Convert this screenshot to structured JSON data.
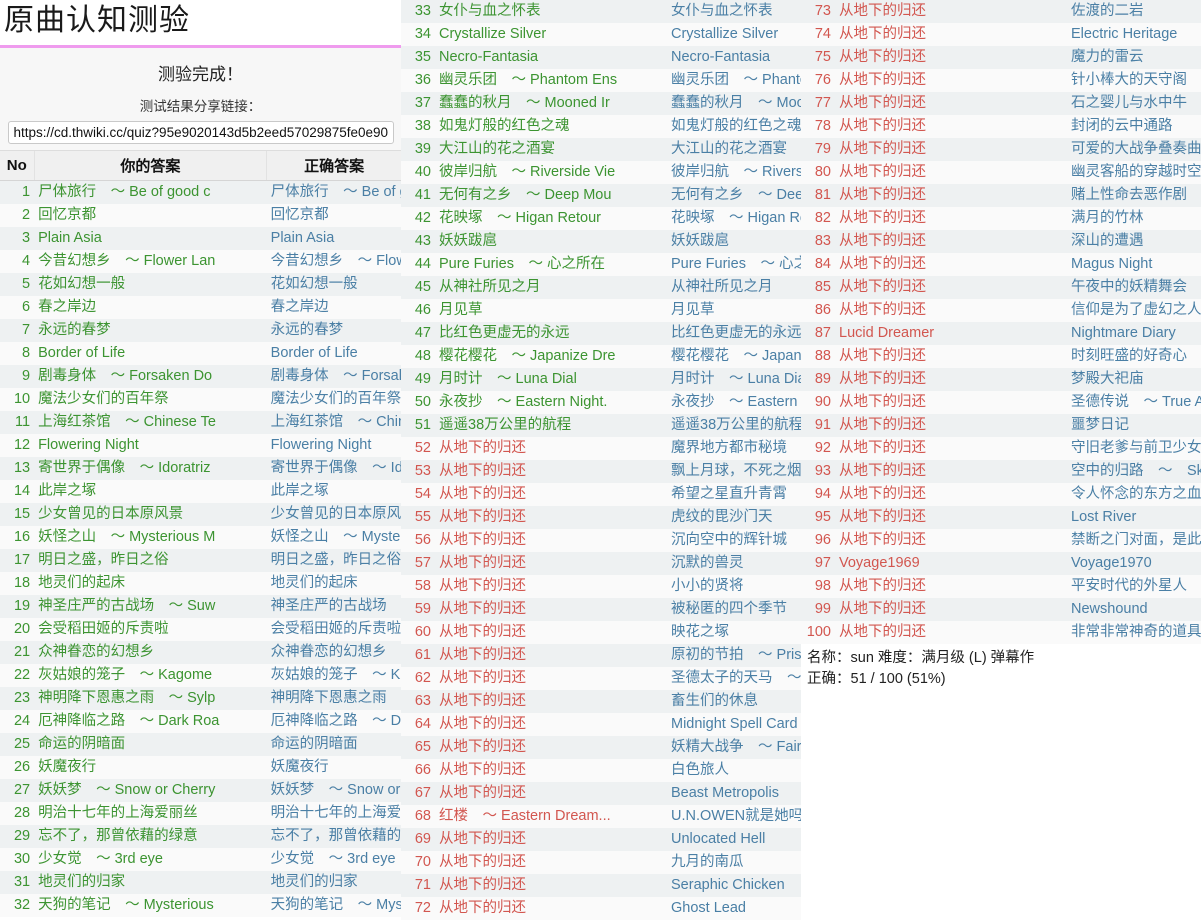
{
  "header": {
    "title": "原曲认知测验",
    "complete_text": "测验完成！",
    "share_label": "测试结果分享链接：",
    "share_url": "https://cd.thwiki.cc/quiz?95e9020143d5b2eed57029875fe0e90d",
    "accent_color": "#ef9bee"
  },
  "table": {
    "columns": [
      "No",
      "你的答案",
      "正确答案"
    ],
    "correct_color": "#3c9431",
    "wrong_color": "#d2564f",
    "answer_color": "#4a7fa5"
  },
  "summary": {
    "line1": "名称：sun 难度：满月级 (L) 弹幕作",
    "line2": "正确：51 / 100 (51%)"
  },
  "rows": [
    {
      "no": "1",
      "user": "尸体旅行　～ Be of good c",
      "correct": "尸体旅行　～ Be of good c",
      "ok": true
    },
    {
      "no": "2",
      "user": "回忆京都",
      "correct": "回忆京都",
      "ok": true
    },
    {
      "no": "3",
      "user": "Plain Asia",
      "correct": "Plain Asia",
      "ok": true
    },
    {
      "no": "4",
      "user": "今昔幻想乡　～ Flower Lan",
      "correct": "今昔幻想乡　～ Flower Lan",
      "ok": true
    },
    {
      "no": "5",
      "user": "花如幻想一般",
      "correct": "花如幻想一般",
      "ok": true
    },
    {
      "no": "6",
      "user": "春之岸边",
      "correct": "春之岸边",
      "ok": true
    },
    {
      "no": "7",
      "user": "永远的春梦",
      "correct": "永远的春梦",
      "ok": true
    },
    {
      "no": "8",
      "user": "Border of Life",
      "correct": "Border of Life",
      "ok": true
    },
    {
      "no": "9",
      "user": "剧毒身体　～ Forsaken Do",
      "correct": "剧毒身体　～ Forsaken Do",
      "ok": true
    },
    {
      "no": "10",
      "user": "魔法少女们的百年祭",
      "correct": "魔法少女们的百年祭",
      "ok": true
    },
    {
      "no": "11",
      "user": "上海红茶馆　～ Chinese Te",
      "correct": "上海红茶馆　～ Chinese Te",
      "ok": true
    },
    {
      "no": "12",
      "user": "Flowering Night",
      "correct": "Flowering Night",
      "ok": true
    },
    {
      "no": "13",
      "user": "寄世界于偶像　～ Idoratriz",
      "correct": "寄世界于偶像　～ Idoratriz",
      "ok": true
    },
    {
      "no": "14",
      "user": "此岸之塚",
      "correct": "此岸之塚",
      "ok": true
    },
    {
      "no": "15",
      "user": "少女曾见的日本原风景",
      "correct": "少女曾见的日本原风景",
      "ok": true
    },
    {
      "no": "16",
      "user": "妖怪之山　～ Mysterious M",
      "correct": "妖怪之山　～ Mysterious M",
      "ok": true
    },
    {
      "no": "17",
      "user": "明日之盛，昨日之俗",
      "correct": "明日之盛，昨日之俗",
      "ok": true
    },
    {
      "no": "18",
      "user": "地灵们的起床",
      "correct": "地灵们的起床",
      "ok": true
    },
    {
      "no": "19",
      "user": "神圣庄严的古战场　～ Suw",
      "correct": "神圣庄严的古战场　～ Suw",
      "ok": true
    },
    {
      "no": "20",
      "user": "会受稻田姬的斥责啦",
      "correct": "会受稻田姬的斥责啦",
      "ok": true
    },
    {
      "no": "21",
      "user": "众神眷恋的幻想乡",
      "correct": "众神眷恋的幻想乡",
      "ok": true
    },
    {
      "no": "22",
      "user": "灰姑娘的笼子　～ Kagome",
      "correct": "灰姑娘的笼子　～ Kagome",
      "ok": true
    },
    {
      "no": "23",
      "user": "神明降下恩惠之雨　～ Sylp",
      "correct": "神明降下恩惠之雨　～ Sylp",
      "ok": true
    },
    {
      "no": "24",
      "user": "厄神降临之路　～ Dark Roa",
      "correct": "厄神降临之路　～ Dark Roa",
      "ok": true
    },
    {
      "no": "25",
      "user": "命运的阴暗面",
      "correct": "命运的阴暗面",
      "ok": true
    },
    {
      "no": "26",
      "user": "妖魔夜行",
      "correct": "妖魔夜行",
      "ok": true
    },
    {
      "no": "27",
      "user": "妖妖梦　～ Snow or Cherry",
      "correct": "妖妖梦　～ Snow or Cherry",
      "ok": true
    },
    {
      "no": "28",
      "user": "明治十七年的上海爱丽丝",
      "correct": "明治十七年的上海爱丽丝",
      "ok": true
    },
    {
      "no": "29",
      "user": "忘不了，那曾依藉的绿意",
      "correct": "忘不了，那曾依藉的绿意",
      "ok": true
    },
    {
      "no": "30",
      "user": "少女觉　～ 3rd eye",
      "correct": "少女觉　～ 3rd eye",
      "ok": true
    },
    {
      "no": "31",
      "user": "地灵们的归家",
      "correct": "地灵们的归家",
      "ok": true
    },
    {
      "no": "32",
      "user": "天狗的笔记　～ Mysterious",
      "correct": "天狗的笔记　～ Mysterious",
      "ok": true
    },
    {
      "no": "33",
      "user": "女仆与血之怀表",
      "correct": "女仆与血之怀表",
      "ok": true
    },
    {
      "no": "34",
      "user": "Crystallize Silver",
      "correct": "Crystallize Silver",
      "ok": true
    },
    {
      "no": "35",
      "user": "Necro-Fantasia",
      "correct": "Necro-Fantasia",
      "ok": true
    },
    {
      "no": "36",
      "user": "幽灵乐团　～ Phantom Ens",
      "correct": "幽灵乐团　～ Phantom Ens",
      "ok": true
    },
    {
      "no": "37",
      "user": "蠢蠢的秋月　～ Mooned Ir",
      "correct": "蠢蠢的秋月　～ Mooned Ir",
      "ok": true
    },
    {
      "no": "38",
      "user": "如鬼灯般的红色之魂",
      "correct": "如鬼灯般的红色之魂",
      "ok": true
    },
    {
      "no": "39",
      "user": "大江山的花之酒宴",
      "correct": "大江山的花之酒宴",
      "ok": true
    },
    {
      "no": "40",
      "user": "彼岸归航　～ Riverside Vie",
      "correct": "彼岸归航　～ Riverside Vie",
      "ok": true
    },
    {
      "no": "41",
      "user": "无何有之乡　～ Deep Mou",
      "correct": "无何有之乡　～ Deep Mou",
      "ok": true
    },
    {
      "no": "42",
      "user": "花映塚　～ Higan Retour",
      "correct": "花映塚　～ Higan Retour",
      "ok": true
    },
    {
      "no": "43",
      "user": "妖妖跋扈",
      "correct": "妖妖跋扈",
      "ok": true
    },
    {
      "no": "44",
      "user": "Pure Furies　～ 心之所在",
      "correct": "Pure Furies　～ 心之所在",
      "ok": true
    },
    {
      "no": "45",
      "user": "从神社所见之月",
      "correct": "从神社所见之月",
      "ok": true
    },
    {
      "no": "46",
      "user": "月见草",
      "correct": "月见草",
      "ok": true
    },
    {
      "no": "47",
      "user": "比红色更虚无的永远",
      "correct": "比红色更虚无的永远",
      "ok": true
    },
    {
      "no": "48",
      "user": "樱花樱花　～ Japanize Dre",
      "correct": "樱花樱花　～ Japanize Dre",
      "ok": true
    },
    {
      "no": "49",
      "user": "月时计　～ Luna Dial",
      "correct": "月时计　～ Luna Dial",
      "ok": true
    },
    {
      "no": "50",
      "user": "永夜抄　～ Eastern Night.",
      "correct": "永夜抄　～ Eastern Night.",
      "ok": true
    },
    {
      "no": "51",
      "user": "遥遥38万公里的航程",
      "correct": "遥遥38万公里的航程",
      "ok": true
    },
    {
      "no": "52",
      "user": "从地下的归还",
      "correct": "魔界地方都市秘境",
      "ok": false
    },
    {
      "no": "53",
      "user": "从地下的归还",
      "correct": "飘上月球，不死之烟",
      "ok": false
    },
    {
      "no": "54",
      "user": "从地下的归还",
      "correct": "希望之星直升青霄",
      "ok": false
    },
    {
      "no": "55",
      "user": "从地下的归还",
      "correct": "虎纹的毘沙门天",
      "ok": false
    },
    {
      "no": "56",
      "user": "从地下的归还",
      "correct": "沉向空中的辉针城",
      "ok": false
    },
    {
      "no": "57",
      "user": "从地下的归还",
      "correct": "沉默的兽灵",
      "ok": false
    },
    {
      "no": "58",
      "user": "从地下的归还",
      "correct": "小小的贤将",
      "ok": false
    },
    {
      "no": "59",
      "user": "从地下的归还",
      "correct": "被秘匿的四个季节",
      "ok": false
    },
    {
      "no": "60",
      "user": "从地下的归还",
      "correct": "映花之塚",
      "ok": false
    },
    {
      "no": "61",
      "user": "从地下的归还",
      "correct": "原初的节拍　～ Pristine Be",
      "ok": false
    },
    {
      "no": "62",
      "user": "从地下的归还",
      "correct": "圣德太子的天马　～ Dark P",
      "ok": false
    },
    {
      "no": "63",
      "user": "从地下的归还",
      "correct": "畜生们的休息",
      "ok": false
    },
    {
      "no": "64",
      "user": "从地下的归还",
      "correct": "Midnight Spell Card",
      "ok": false
    },
    {
      "no": "65",
      "user": "从地下的归还",
      "correct": "妖精大战争　～ Fairy Wars",
      "ok": false
    },
    {
      "no": "66",
      "user": "从地下的归还",
      "correct": "白色旅人",
      "ok": false
    },
    {
      "no": "67",
      "user": "从地下的归还",
      "correct": "Beast Metropolis",
      "ok": false
    },
    {
      "no": "68",
      "user": "红楼　～ Eastern Dream...",
      "correct": "U.N.OWEN就是她吗？",
      "ok": false
    },
    {
      "no": "69",
      "user": "从地下的归还",
      "correct": "Unlocated Hell",
      "ok": false
    },
    {
      "no": "70",
      "user": "从地下的归还",
      "correct": "九月的南瓜",
      "ok": false
    },
    {
      "no": "71",
      "user": "从地下的归还",
      "correct": "Seraphic Chicken",
      "ok": false
    },
    {
      "no": "72",
      "user": "从地下的归还",
      "correct": "Ghost Lead",
      "ok": false
    },
    {
      "no": "73",
      "user": "从地下的归还",
      "correct": "佐渡的二岩",
      "ok": false
    },
    {
      "no": "74",
      "user": "从地下的归还",
      "correct": "Electric Heritage",
      "ok": false
    },
    {
      "no": "75",
      "user": "从地下的归还",
      "correct": "魔力的雷云",
      "ok": false
    },
    {
      "no": "76",
      "user": "从地下的归还",
      "correct": "针小棒大的天守阁",
      "ok": false
    },
    {
      "no": "77",
      "user": "从地下的归还",
      "correct": "石之婴儿与水中牛",
      "ok": false
    },
    {
      "no": "78",
      "user": "从地下的归还",
      "correct": "封闭的云中通路",
      "ok": false
    },
    {
      "no": "79",
      "user": "从地下的归还",
      "correct": "可爱的大战争叠奏曲",
      "ok": false
    },
    {
      "no": "80",
      "user": "从地下的归还",
      "correct": "幽灵客船的穿越时空之旅",
      "ok": false
    },
    {
      "no": "81",
      "user": "从地下的归还",
      "correct": "赌上性命去恶作剧",
      "ok": false
    },
    {
      "no": "82",
      "user": "从地下的归还",
      "correct": "满月的竹林",
      "ok": false
    },
    {
      "no": "83",
      "user": "从地下的归还",
      "correct": "深山的遭遇",
      "ok": false
    },
    {
      "no": "84",
      "user": "从地下的归还",
      "correct": "Magus Night",
      "ok": false
    },
    {
      "no": "85",
      "user": "从地下的归还",
      "correct": "午夜中的妖精舞会",
      "ok": false
    },
    {
      "no": "86",
      "user": "从地下的归还",
      "correct": "信仰是为了虚幻之人",
      "ok": false
    },
    {
      "no": "87",
      "user": "Lucid Dreamer",
      "correct": "Nightmare Diary",
      "ok": false
    },
    {
      "no": "88",
      "user": "从地下的归还",
      "correct": "时刻旺盛的好奇心",
      "ok": false
    },
    {
      "no": "89",
      "user": "从地下的归还",
      "correct": "梦殿大祀庙",
      "ok": false
    },
    {
      "no": "90",
      "user": "从地下的归还",
      "correct": "圣德传说　～ True Adminis",
      "ok": false
    },
    {
      "no": "91",
      "user": "从地下的归还",
      "correct": "噩梦日记",
      "ok": false
    },
    {
      "no": "92",
      "user": "从地下的归还",
      "correct": "守旧老爹与前卫少女",
      "ok": false
    },
    {
      "no": "93",
      "user": "从地下的归还",
      "correct": "空中的归路　～　Sky Drea",
      "ok": false
    },
    {
      "no": "94",
      "user": "从地下的归还",
      "correct": "令人怀念的东方之血　～ Ol",
      "ok": false
    },
    {
      "no": "95",
      "user": "从地下的归还",
      "correct": "Lost River",
      "ok": false
    },
    {
      "no": "96",
      "user": "从地下的归还",
      "correct": "禁断之门对面，是此世还是彼",
      "ok": false
    },
    {
      "no": "97",
      "user": "Voyage1969",
      "correct": "Voyage1970",
      "ok": false
    },
    {
      "no": "98",
      "user": "从地下的归还",
      "correct": "平安时代的外星人",
      "ok": false
    },
    {
      "no": "99",
      "user": "从地下的归还",
      "correct": "Newshound",
      "ok": false
    },
    {
      "no": "100",
      "user": "从地下的归还",
      "correct": "非常非常神奇的道具们",
      "ok": false
    }
  ]
}
